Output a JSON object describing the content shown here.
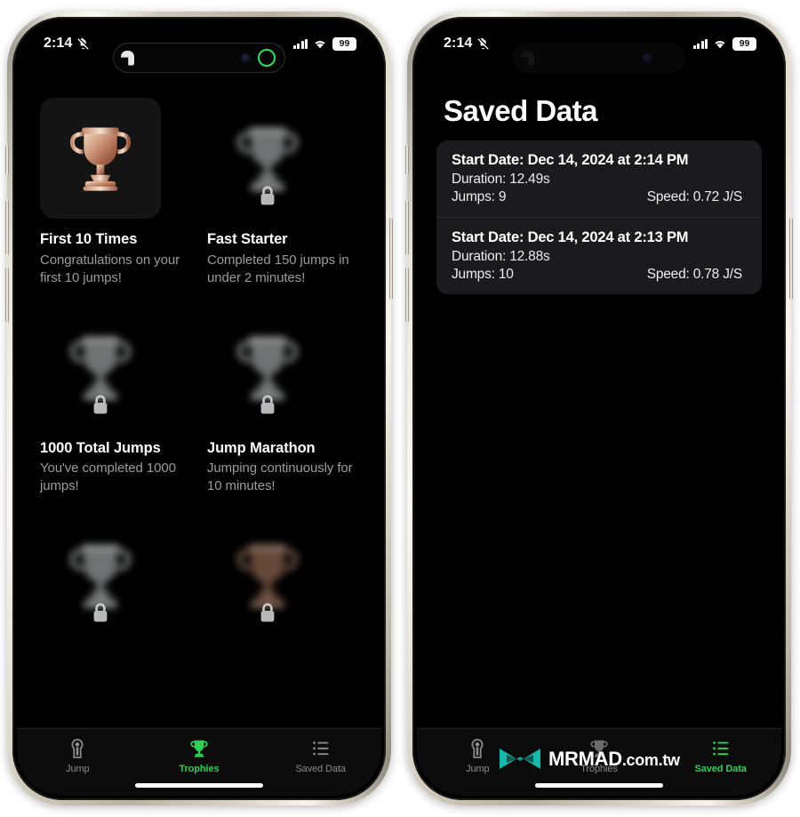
{
  "status_bar": {
    "time": "2:14",
    "mute_icon": "bell-slash-icon",
    "signal_icon": "cellular-signal-icon",
    "wifi_icon": "wifi-icon",
    "battery": "99"
  },
  "dynamic_island": {
    "app_icon": "app-activity-icon",
    "camera_icon": "front-camera-icon",
    "recording_icon": "green-recording-ring-icon"
  },
  "left_phone": {
    "screen_name": "Trophies",
    "trophies": [
      {
        "title": "First 10 Times",
        "desc": "Congratulations on your first 10 jumps!",
        "state": "unlocked",
        "icon": "trophy-icon"
      },
      {
        "title": "Fast Starter",
        "desc": "Completed 150 jumps in under 2 minutes!",
        "state": "locked",
        "icon": "trophy-icon",
        "lock_icon": "lock-icon"
      },
      {
        "title": "1000 Total Jumps",
        "desc": "You've completed 1000 jumps!",
        "state": "locked",
        "icon": "trophy-icon",
        "lock_icon": "lock-icon"
      },
      {
        "title": "Jump Marathon",
        "desc": "Jumping continuously for 10 minutes!",
        "state": "locked",
        "icon": "trophy-icon",
        "lock_icon": "lock-icon"
      },
      {
        "title": "",
        "desc": "",
        "state": "locked",
        "icon": "trophy-icon",
        "lock_icon": "lock-icon"
      },
      {
        "title": "",
        "desc": "",
        "state": "locked-warm",
        "icon": "trophy-icon",
        "lock_icon": "lock-icon"
      }
    ],
    "tabs": [
      {
        "label": "Jump",
        "icon": "person-jump-icon",
        "active": false
      },
      {
        "label": "Trophies",
        "icon": "trophy-icon",
        "active": true
      },
      {
        "label": "Saved Data",
        "icon": "list-bullet-icon",
        "active": false
      }
    ]
  },
  "right_phone": {
    "title": "Saved Data",
    "entries": [
      {
        "start_date": "Start Date: Dec 14, 2024 at 2:14 PM",
        "duration": "Duration: 12.49s",
        "jumps": "Jumps: 9",
        "speed": "Speed: 0.72 J/S"
      },
      {
        "start_date": "Start Date: Dec 14, 2024 at 2:13 PM",
        "duration": "Duration: 12.88s",
        "jumps": "Jumps: 10",
        "speed": "Speed: 0.78 J/S"
      }
    ],
    "tabs": [
      {
        "label": "Jump",
        "icon": "person-jump-icon",
        "active": false
      },
      {
        "label": "Trophies",
        "icon": "trophy-icon",
        "active": false
      },
      {
        "label": "Saved Data",
        "icon": "list-bullet-icon",
        "active": true
      }
    ]
  },
  "watermark": {
    "logo": "mrmad-bowtie-logo",
    "brand": "MRMAD",
    "tld": ".com.tw",
    "color": "#17b8ab"
  },
  "colors": {
    "accent_green": "#2fd155",
    "screen_bg": "#000000",
    "card_bg": "#1b1b1d",
    "secondary_text": "#9b9b9e"
  }
}
